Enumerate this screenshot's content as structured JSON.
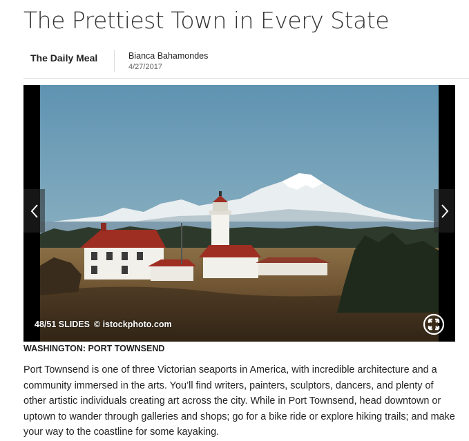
{
  "article": {
    "title": "The Prettiest Town in Every State",
    "source": "The Daily Meal",
    "author": "Bianca Bahamondes",
    "date": "4/27/2017"
  },
  "gallery": {
    "slide_counter": "48/51 SLIDES",
    "credit": "© istockphoto.com",
    "prev_icon": "chevron-left-icon",
    "next_icon": "chevron-right-icon",
    "fullscreen_icon": "fullscreen-icon"
  },
  "slide": {
    "caption_title": "WASHINGTON: PORT TOWNSEND",
    "body": "Port Townsend is one of three Victorian seaports in America, with incredible architecture and a community immersed in the arts. You’ll find writers, painters, sculptors, dancers, and plenty of other artistic individuals creating art across the city. While in Port Townsend, head downtown or uptown to wander through galleries and shops; go for a bike ride or explore hiking trails; and make your way to the coastline for some kayaking."
  }
}
